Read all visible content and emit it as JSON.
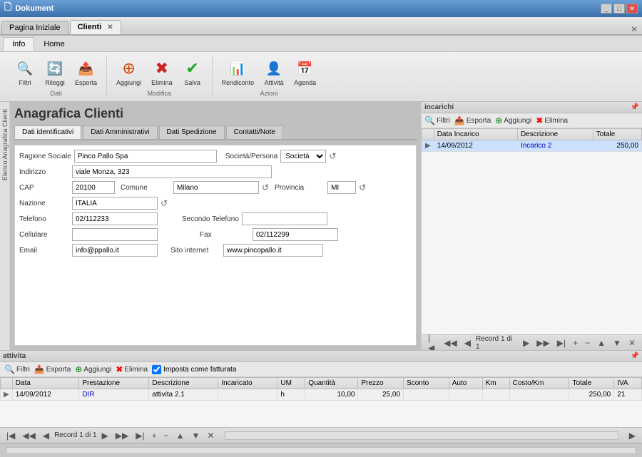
{
  "window": {
    "title": "Dokument",
    "controls": [
      "_",
      "□",
      "✕"
    ]
  },
  "tabs": [
    {
      "label": "Pagina Iniziale",
      "closable": false,
      "active": false
    },
    {
      "label": "Clienti",
      "closable": true,
      "active": true
    }
  ],
  "tab_close": "✕",
  "ribbon": {
    "tabs": [
      "Info",
      "Home"
    ],
    "active_tab": "Info",
    "groups": [
      {
        "label": "Dati",
        "buttons": [
          {
            "icon": "🔍",
            "label": "Filtri"
          },
          {
            "icon": "🔄",
            "label": "Rileggi"
          },
          {
            "icon": "📤",
            "label": "Esporta"
          }
        ]
      },
      {
        "label": "Modifica",
        "buttons": [
          {
            "icon": "➕",
            "label": "Aggiungi",
            "color": "green"
          },
          {
            "icon": "✖",
            "label": "Elimina",
            "color": "red"
          },
          {
            "icon": "✔",
            "label": "Salva",
            "color": "green"
          }
        ]
      },
      {
        "label": "Azioni",
        "buttons": [
          {
            "icon": "📊",
            "label": "Rendiconto"
          },
          {
            "icon": "👤",
            "label": "Attività"
          },
          {
            "icon": "📅",
            "label": "Agenda"
          }
        ]
      }
    ]
  },
  "sidebar": {
    "label": "Elenco Anagrafica Clienti"
  },
  "client_form": {
    "title": "Anagrafica Clienti",
    "sub_tabs": [
      {
        "label": "Dati identificativi",
        "active": true
      },
      {
        "label": "Dati Amministrativi",
        "active": false
      },
      {
        "label": "Dati Spedizione",
        "active": false
      },
      {
        "label": "Contatti/Note",
        "active": false
      }
    ],
    "fields": {
      "ragione_sociale_label": "Ragione Sociale",
      "ragione_sociale_value": "Pinco Pallo Spa",
      "societa_persona_label": "Società/Persona",
      "societa_persona_value": "Società",
      "indirizzo_label": "Indirizzo",
      "indirizzo_value": "viale Monza, 323",
      "cap_label": "CAP",
      "cap_value": "20100",
      "comune_label": "Comune",
      "comune_value": "Milano",
      "provincia_label": "Provincia",
      "provincia_value": "MI",
      "nazione_label": "Nazione",
      "nazione_value": "ITALIA",
      "telefono_label": "Telefono",
      "telefono_value": "02/112233",
      "secondo_telefono_label": "Secondo Telefono",
      "secondo_telefono_value": "",
      "cellulare_label": "Cellulare",
      "cellulare_value": "",
      "fax_label": "Fax",
      "fax_value": "02/112299",
      "email_label": "Email",
      "email_value": "info@ppallo.it",
      "sito_internet_label": "Sito internet",
      "sito_internet_value": "www.pincopallo.it"
    }
  },
  "incarichi": {
    "title": "incarichi",
    "toolbar": {
      "filtri": "Filtri",
      "esporta": "Esporta",
      "aggiungi": "Aggiungi",
      "elimina": "Elimina"
    },
    "columns": [
      "Data Incarico",
      "Descrizione",
      "Totale"
    ],
    "rows": [
      {
        "data": "14/09/2012",
        "descrizione": "Incarico 2",
        "totale": "250,00",
        "selected": true
      }
    ],
    "nav": {
      "record_label": "Record 1 di 1"
    }
  },
  "attivita": {
    "title": "attivita",
    "toolbar": {
      "filtri": "Filtri",
      "esporta": "Esporta",
      "aggiungi": "Aggiungi",
      "elimina": "Elimina",
      "imposta_label": "Imposta come fatturata"
    },
    "columns": [
      "Data",
      "Prestazione",
      "Descrizione",
      "Incaricato",
      "UM",
      "Quantità",
      "Prezzo",
      "Sconto",
      "Auto",
      "Km",
      "Costo/Km",
      "Totale",
      "IVA"
    ],
    "rows": [
      {
        "data": "14/09/2012",
        "prestazione": "DIR",
        "descrizione": "attivita 2.1",
        "incaricato": "",
        "um": "h",
        "quantita": "10,00",
        "prezzo": "25,00",
        "sconto": "",
        "auto": "",
        "km": "",
        "costo_km": "",
        "totale": "250,00",
        "iva": "21"
      }
    ],
    "nav": {
      "record_label": "Record 1 di 1"
    }
  }
}
